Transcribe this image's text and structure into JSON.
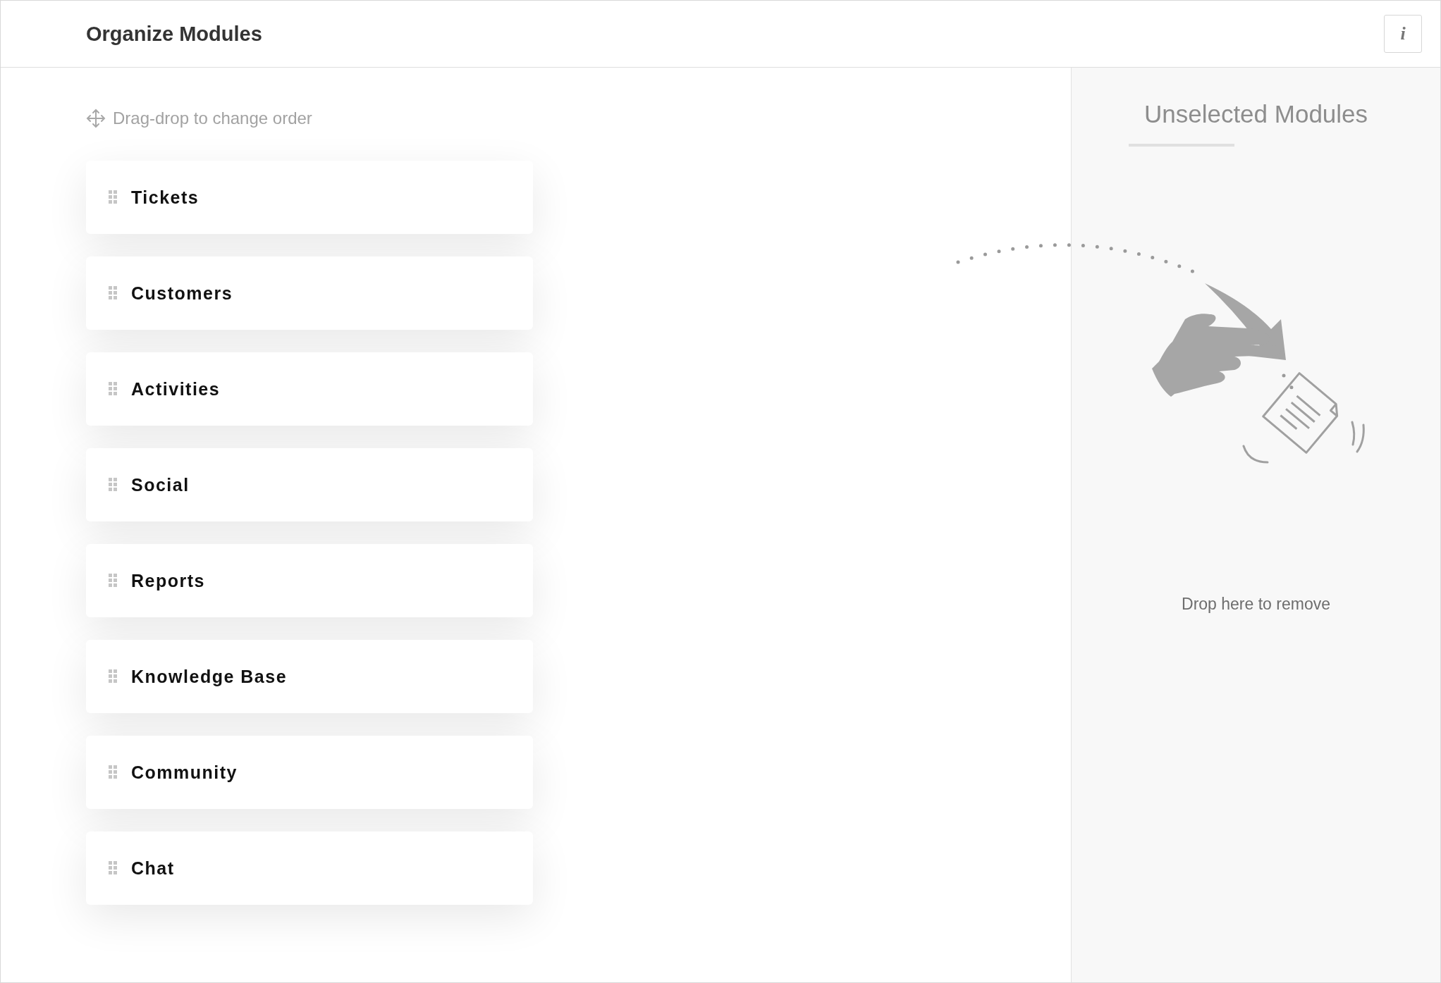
{
  "header": {
    "title": "Organize Modules",
    "info_button": "i"
  },
  "hint": "Drag-drop to change order",
  "modules": [
    {
      "label": "Tickets"
    },
    {
      "label": "Customers"
    },
    {
      "label": "Activities"
    },
    {
      "label": "Social"
    },
    {
      "label": "Reports"
    },
    {
      "label": "Knowledge Base"
    },
    {
      "label": "Community"
    },
    {
      "label": "Chat"
    }
  ],
  "unselected_panel": {
    "title": "Unselected Modules",
    "drop_text": "Drop here to remove"
  }
}
